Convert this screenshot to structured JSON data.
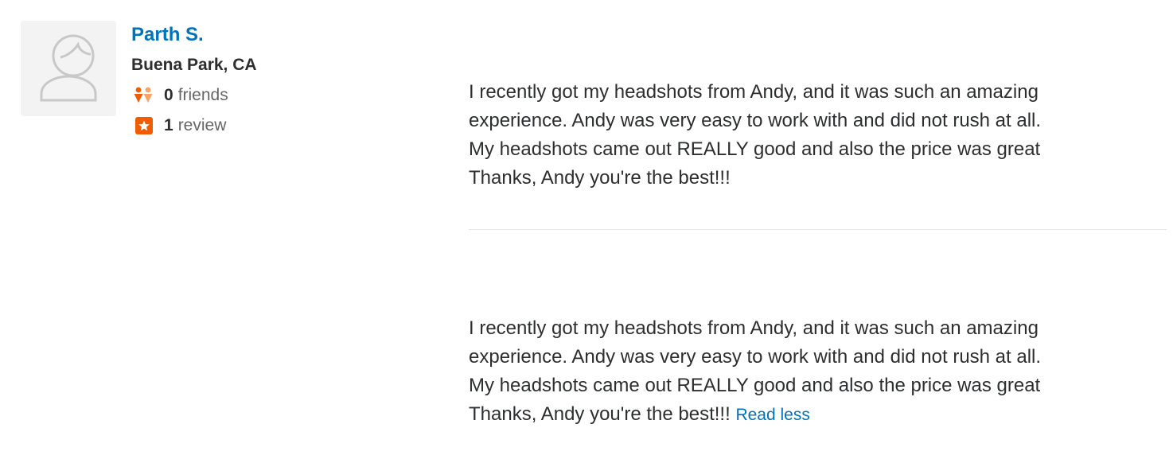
{
  "user": {
    "name": "Parth S.",
    "location": "Buena Park, CA",
    "friends_count": "0",
    "friends_label": "friends",
    "reviews_count": "1",
    "reviews_label": "review"
  },
  "reviews": [
    {
      "lines": [
        "I recently got my headshots from Andy, and it was such an amazing",
        "experience. Andy was very easy to work with and did not rush at all.",
        "My headshots came out REALLY good and also the price was great",
        "Thanks, Andy you're the best!!!"
      ]
    },
    {
      "lines": [
        "I recently got my headshots from Andy, and it was such an amazing",
        "experience. Andy was very easy to work with and did not rush at all.",
        "My headshots came out REALLY good and also the price was great",
        "Thanks, Andy you're the best!!!"
      ],
      "read_less_label": "Read less"
    }
  ],
  "icons": {
    "avatar": "default-user-avatar-icon",
    "friends": "friends-icon",
    "reviews": "review-star-icon"
  },
  "colors": {
    "link": "#0073bb",
    "friends_icon": "#f15c00",
    "friends_icon_light": "#f5a46b",
    "review_icon": "#f15c00"
  }
}
